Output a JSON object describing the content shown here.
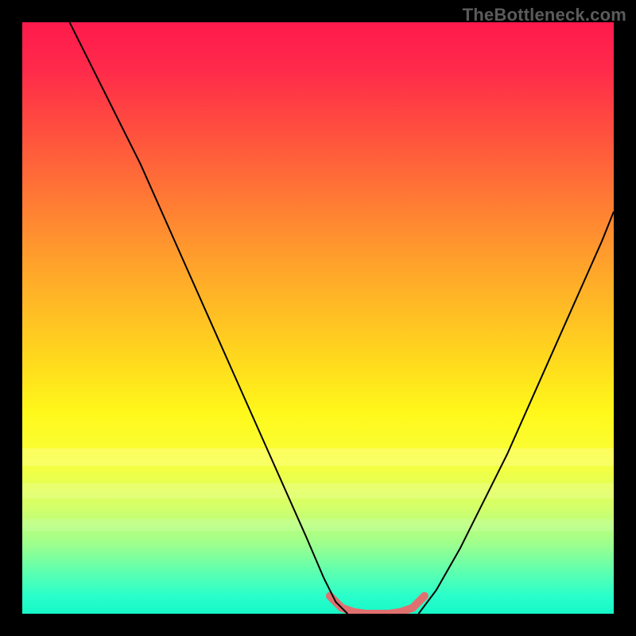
{
  "watermark": "TheBottleneck.com",
  "chart_data": {
    "type": "line",
    "title": "",
    "xlabel": "",
    "ylabel": "",
    "xlim": [
      0,
      100
    ],
    "ylim": [
      0,
      100
    ],
    "grid": false,
    "legend": false,
    "background_gradient": {
      "direction": "vertical",
      "stops": [
        {
          "pos": 0.0,
          "color": "#ff1a4d"
        },
        {
          "pos": 0.3,
          "color": "#ff7a34"
        },
        {
          "pos": 0.55,
          "color": "#ffd21f"
        },
        {
          "pos": 0.74,
          "color": "#f9ff3a"
        },
        {
          "pos": 0.88,
          "color": "#a0ff8c"
        },
        {
          "pos": 1.0,
          "color": "#17f7c7"
        }
      ]
    },
    "series": [
      {
        "name": "left-curve",
        "color": "#000000",
        "stroke_width": 2,
        "x": [
          8,
          12,
          16,
          20,
          24,
          28,
          32,
          36,
          40,
          44,
          48,
          51,
          53,
          55
        ],
        "y": [
          100,
          92,
          84,
          76,
          67,
          58,
          49,
          40,
          31,
          22,
          13,
          6,
          2,
          0
        ]
      },
      {
        "name": "right-curve",
        "color": "#000000",
        "stroke_width": 2,
        "x": [
          67,
          70,
          74,
          78,
          82,
          86,
          90,
          94,
          98,
          100
        ],
        "y": [
          0,
          4,
          11,
          19,
          27,
          36,
          45,
          54,
          63,
          68
        ]
      },
      {
        "name": "bottom-flat-highlight",
        "color": "#e07070",
        "stroke_width": 10,
        "stroke_linecap": "round",
        "x": [
          52,
          54,
          56,
          58,
          60,
          62,
          64,
          66,
          68
        ],
        "y": [
          3,
          1,
          0.3,
          0,
          0,
          0,
          0.3,
          1,
          3
        ]
      }
    ],
    "annotations": []
  }
}
